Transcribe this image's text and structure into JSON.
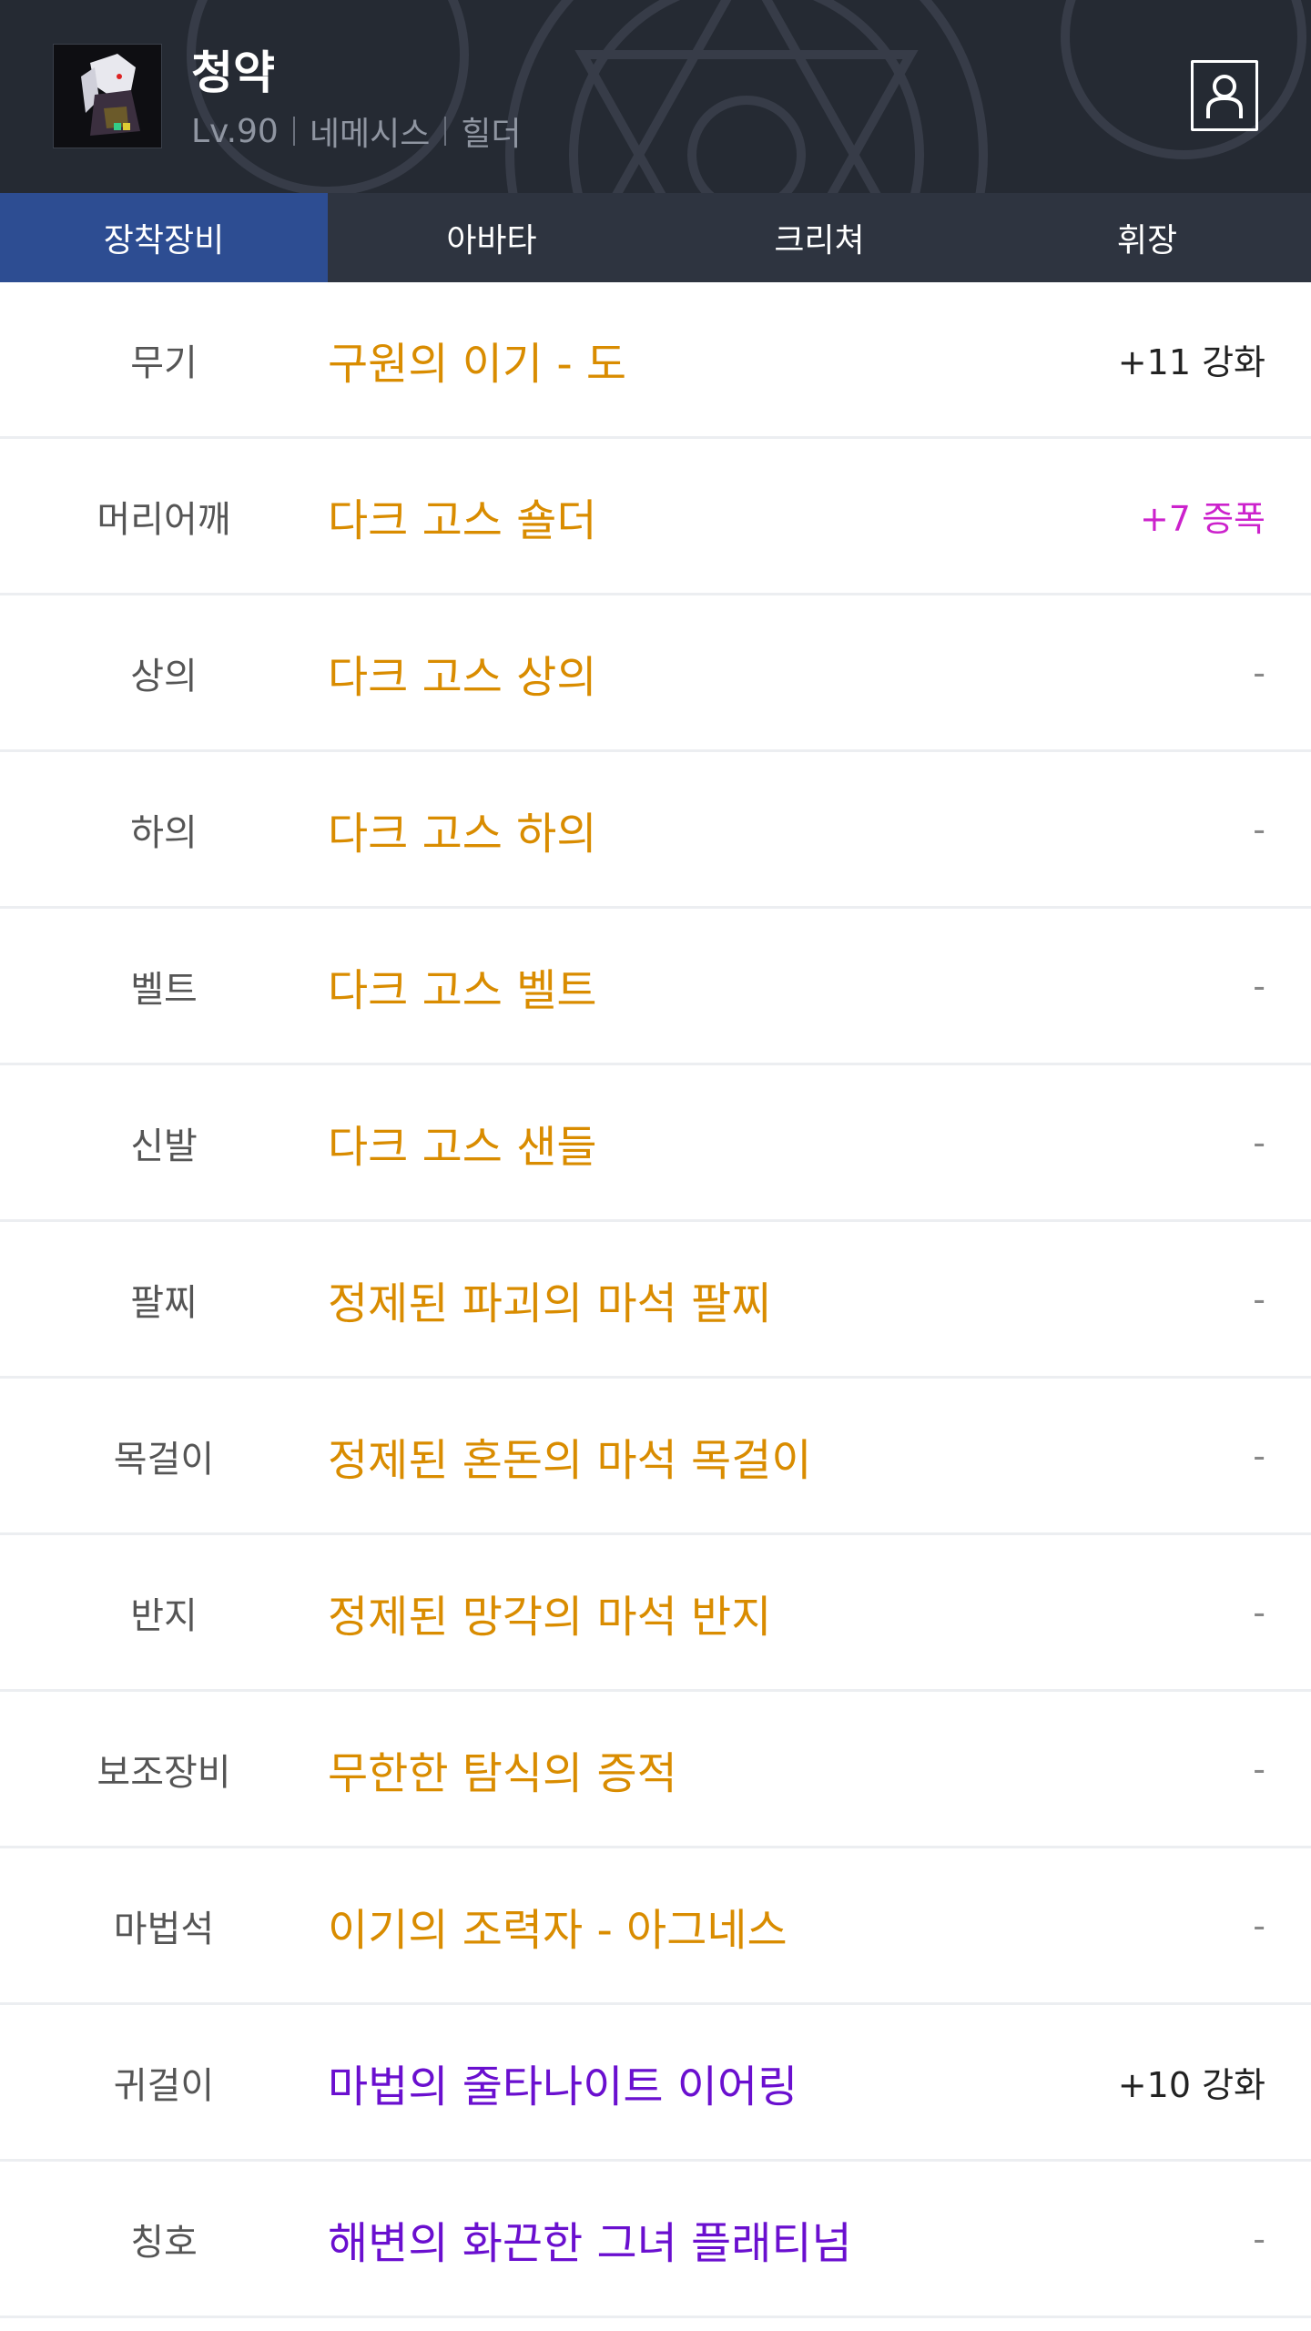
{
  "header": {
    "character_name": "청약",
    "level": "Lv.90",
    "server": "네메시스",
    "job": "힐더",
    "profile_icon": "profile-icon"
  },
  "tabs": [
    {
      "label": "장착장비",
      "active": true
    },
    {
      "label": "아바타",
      "active": false
    },
    {
      "label": "크리쳐",
      "active": false
    },
    {
      "label": "휘장",
      "active": false
    }
  ],
  "equipment": [
    {
      "slot": "무기",
      "item": "구원의 이기 - 도",
      "grade": "legendary",
      "extra": "+11 강화",
      "extra_type": "reinforce"
    },
    {
      "slot": "머리어깨",
      "item": "다크 고스 숄더",
      "grade": "legendary",
      "extra": "+7 증폭",
      "extra_type": "amplify"
    },
    {
      "slot": "상의",
      "item": "다크 고스 상의",
      "grade": "legendary",
      "extra": "-",
      "extra_type": "none"
    },
    {
      "slot": "하의",
      "item": "다크 고스 하의",
      "grade": "legendary",
      "extra": "-",
      "extra_type": "none"
    },
    {
      "slot": "벨트",
      "item": "다크 고스 벨트",
      "grade": "legendary",
      "extra": "-",
      "extra_type": "none"
    },
    {
      "slot": "신발",
      "item": "다크 고스 샌들",
      "grade": "legendary",
      "extra": "-",
      "extra_type": "none"
    },
    {
      "slot": "팔찌",
      "item": "정제된 파괴의 마석 팔찌",
      "grade": "legendary",
      "extra": "-",
      "extra_type": "none"
    },
    {
      "slot": "목걸이",
      "item": "정제된 혼돈의 마석 목걸이",
      "grade": "legendary",
      "extra": "-",
      "extra_type": "none"
    },
    {
      "slot": "반지",
      "item": "정제된 망각의 마석 반지",
      "grade": "legendary",
      "extra": "-",
      "extra_type": "none"
    },
    {
      "slot": "보조장비",
      "item": "무한한 탐식의 증적",
      "grade": "legendary",
      "extra": "-",
      "extra_type": "none"
    },
    {
      "slot": "마법석",
      "item": "이기의 조력자 - 아그네스",
      "grade": "legendary",
      "extra": "-",
      "extra_type": "none"
    },
    {
      "slot": "귀걸이",
      "item": "마법의 줄타나이트 이어링",
      "grade": "epic",
      "extra": "+10 강화",
      "extra_type": "reinforce"
    },
    {
      "slot": "칭호",
      "item": "해변의 화끈한 그녀 플래티넘",
      "grade": "epic",
      "extra": "-",
      "extra_type": "none"
    }
  ],
  "colors": {
    "header_bg": "#252a33",
    "tab_bg": "#2e3440",
    "tab_active_bg": "#2d4d92",
    "legendary_item": "#d98c00",
    "epic_item": "#6a0fcf",
    "amplify_text": "#cc22cc"
  }
}
